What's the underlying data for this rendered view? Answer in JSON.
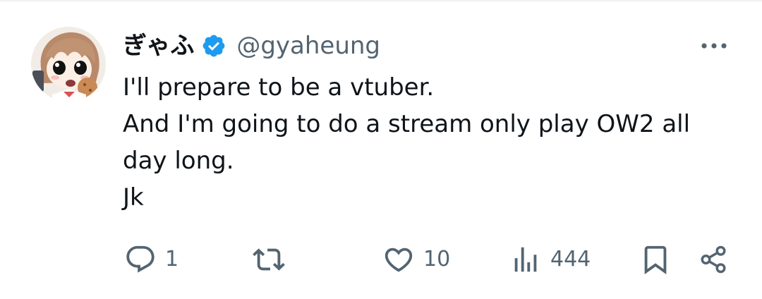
{
  "tweet": {
    "author": {
      "display_name": "ぎゃふ",
      "handle": "@gyaheung",
      "verified": true,
      "avatar_icon": "anime-character-avatar"
    },
    "text_lines": [
      "I'll prepare to be a vtuber.",
      "And I'm going to do a stream only play OW2 all",
      "day long.",
      "Jk"
    ],
    "actions": {
      "reply": {
        "icon": "reply-icon",
        "count": "1"
      },
      "retweet": {
        "icon": "retweet-icon",
        "count": ""
      },
      "like": {
        "icon": "heart-icon",
        "count": "10"
      },
      "views": {
        "icon": "views-icon",
        "count": "444"
      },
      "bookmark": {
        "icon": "bookmark-icon"
      },
      "share": {
        "icon": "share-icon"
      }
    },
    "more_icon": "more-icon"
  },
  "colors": {
    "text_primary": "#0f1419",
    "text_secondary": "#536471",
    "verified_blue": "#1d9bf0",
    "divider": "#eff3f4"
  }
}
